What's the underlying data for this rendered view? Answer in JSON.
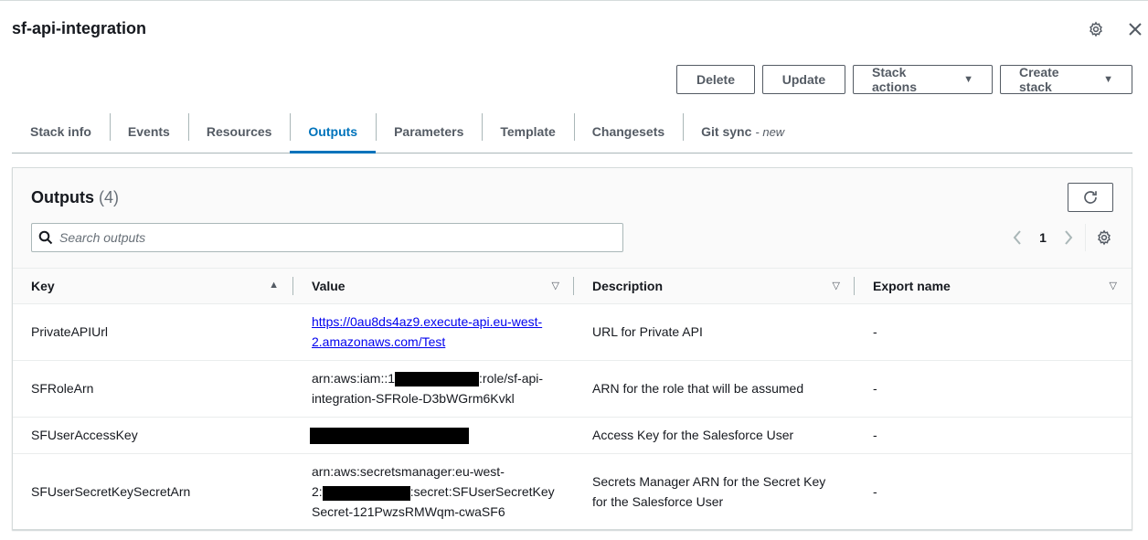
{
  "header": {
    "title": "sf-api-integration"
  },
  "actions": {
    "delete": "Delete",
    "update": "Update",
    "stack_actions": "Stack actions",
    "create_stack": "Create stack"
  },
  "tabs": [
    {
      "label": "Stack info"
    },
    {
      "label": "Events"
    },
    {
      "label": "Resources"
    },
    {
      "label": "Outputs",
      "active": true
    },
    {
      "label": "Parameters"
    },
    {
      "label": "Template"
    },
    {
      "label": "Changesets"
    },
    {
      "label": "Git sync",
      "suffix": "- new"
    }
  ],
  "outputs": {
    "title": "Outputs",
    "count": "(4)",
    "search_placeholder": "Search outputs",
    "page": "1",
    "columns": {
      "key": "Key",
      "value": "Value",
      "description": "Description",
      "export_name": "Export name"
    },
    "rows": [
      {
        "key": "PrivateAPIUrl",
        "value_line1": "https://0au8ds4az9.execute-api.eu-west-",
        "value_line2": "2.amazonaws.com/Test",
        "description": "URL for Private API",
        "export": "-"
      },
      {
        "key": "SFRoleArn",
        "value_pre": "arn:aws:iam::1",
        "value_post": ":role/sf-api-",
        "value_line2": "integration-SFRole-D3bWGrm6Kvkl",
        "description": "ARN for the role that will be assumed",
        "export": "-"
      },
      {
        "key": "SFUserAccessKey",
        "description": "Access Key for the Salesforce User",
        "export": "-"
      },
      {
        "key": "SFUserSecretKeySecretArn",
        "value_line1": "arn:aws:secretsmanager:eu-west-",
        "value_pre": "2:",
        "value_post": ":secret:SFUserSecretKey",
        "value_line3": "Secret-121PwzsRMWqm-cwaSF6",
        "description_line1": "Secrets Manager ARN for the Secret Key",
        "description_line2": "for the Salesforce User",
        "export": "-"
      }
    ]
  }
}
